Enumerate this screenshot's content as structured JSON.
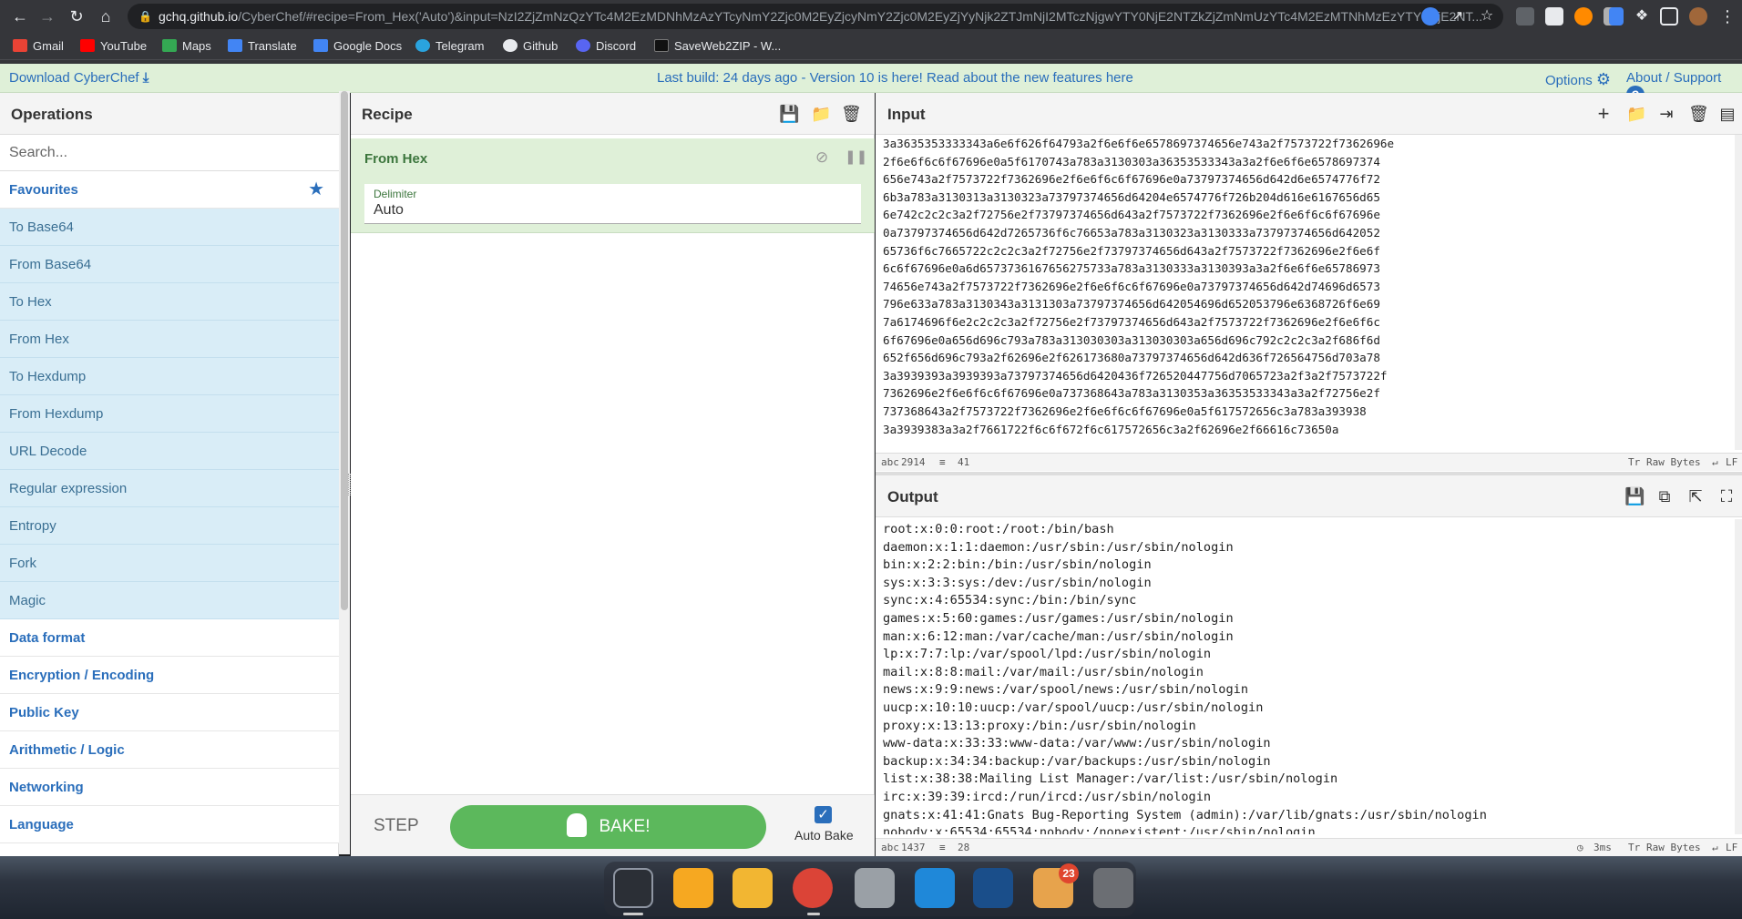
{
  "browser": {
    "url_host": "gchq.github.io",
    "url_rest": "/CyberChef/#recipe=From_Hex('Auto')&input=NzI2ZjZmNzQzYTc4M2EzMDNhMzAzYTcyNmY2Zjc0M2EyZjcyNmY2Zjc0M2EyZjYyNjk2ZTJmNjI2MTczNjgwYTY0NjE2NTZkZjZmNmUzYTc4M2EzMTNhMzEzYTY0NjE2NT...",
    "bookmarks": [
      "Gmail",
      "YouTube",
      "Maps",
      "Translate",
      "Google Docs",
      "Telegram",
      "Github",
      "Discord",
      "SaveWeb2ZIP - W..."
    ]
  },
  "banner": {
    "download": "Download CyberChef",
    "build": "Last build: 24 days ago - Version 10 is here! Read about the new features here",
    "options": "Options",
    "about": "About / Support"
  },
  "operations": {
    "title": "Operations",
    "search_placeholder": "Search...",
    "favourites": "Favourites",
    "items": [
      "To Base64",
      "From Base64",
      "To Hex",
      "From Hex",
      "To Hexdump",
      "From Hexdump",
      "URL Decode",
      "Regular expression",
      "Entropy",
      "Fork",
      "Magic"
    ],
    "categories": [
      "Data format",
      "Encryption / Encoding",
      "Public Key",
      "Arithmetic / Logic",
      "Networking",
      "Language"
    ]
  },
  "recipe": {
    "title": "Recipe",
    "operation": "From Hex",
    "delimiter_label": "Delimiter",
    "delimiter_value": "Auto",
    "step": "STEP",
    "bake": "BAKE!",
    "auto_bake": "Auto Bake",
    "auto_bake_checked": true
  },
  "input": {
    "title": "Input",
    "text": "3a3635353333343a6e6f626f64793a2f6e6f6e6578697374656e743a2f7573722f7362696e\n2f6e6f6c6f67696e0a5f6170743a783a3130303a36353533343a3a2f6e6f6e6578697374\n656e743a2f7573722f7362696e2f6e6f6c6f67696e0a73797374656d642d6e6574776f72\n6b3a783a3130313a3130323a73797374656d64204e6574776f726b204d616e6167656d65\n6e742c2c2c3a2f72756e2f73797374656d643a2f7573722f7362696e2f6e6f6c6f67696e\n0a73797374656d642d7265736f6c76653a783a3130323a3130333a73797374656d642052\n65736f6c7665722c2c2c3a2f72756e2f73797374656d643a2f7573722f7362696e2f6e6f\n6c6f67696e0a6d6573736167656275733a783a3130333a3130393a3a2f6e6f6e65786973\n74656e743a2f7573722f7362696e2f6e6f6c6f67696e0a73797374656d642d74696d6573\n796e633a783a3130343a3131303a73797374656d642054696d652053796e6368726f6e69\n7a6174696f6e2c2c2c3a2f72756e2f73797374656d643a2f7573722f7362696e2f6e6f6c\n6f67696e0a656d696c793a783a313030303a313030303a656d696c792c2c2c3a2f686f6d\n652f656d696c793a2f62696e2f626173680a73797374656d642d636f726564756d703a78\n3a3939393a3939393a73797374656d6420436f726520447756d7065723a2f3a2f7573722f\n7362696e2f6e6f6c6f67696e0a737368643a783a3130353a36353533343a3a2f72756e2f\n737368643a2f7573722f7362696e2f6e6f6c6f67696e0a5f617572656c3a783a393938\n3a3939383a3a2f7661722f6c6f672f6c617572656c3a2f62696e2f66616c73650a",
    "chars_label": "2914",
    "lines_label": "41",
    "raw_bytes": "Raw Bytes",
    "eol": "LF"
  },
  "output": {
    "title": "Output",
    "text": "root:x:0:0:root:/root:/bin/bash\ndaemon:x:1:1:daemon:/usr/sbin:/usr/sbin/nologin\nbin:x:2:2:bin:/bin:/usr/sbin/nologin\nsys:x:3:3:sys:/dev:/usr/sbin/nologin\nsync:x:4:65534:sync:/bin:/bin/sync\ngames:x:5:60:games:/usr/games:/usr/sbin/nologin\nman:x:6:12:man:/var/cache/man:/usr/sbin/nologin\nlp:x:7:7:lp:/var/spool/lpd:/usr/sbin/nologin\nmail:x:8:8:mail:/var/mail:/usr/sbin/nologin\nnews:x:9:9:news:/var/spool/news:/usr/sbin/nologin\nuucp:x:10:10:uucp:/var/spool/uucp:/usr/sbin/nologin\nproxy:x:13:13:proxy:/bin:/usr/sbin/nologin\nwww-data:x:33:33:www-data:/var/www:/usr/sbin/nologin\nbackup:x:34:34:backup:/var/backups:/usr/sbin/nologin\nlist:x:38:38:Mailing List Manager:/var/list:/usr/sbin/nologin\nirc:x:39:39:ircd:/run/ircd:/usr/sbin/nologin\ngnats:x:41:41:Gnats Bug-Reporting System (admin):/var/lib/gnats:/usr/sbin/nologin\nnobody:x:65534:65534:nobody:/nonexistent:/usr/sbin/nologin",
    "chars_label": "1437",
    "lines_label": "28",
    "time": "3ms",
    "raw_bytes": "Raw Bytes",
    "eol": "LF"
  },
  "dock": {
    "badge_count": "23"
  },
  "colors": {
    "accent": "#2a6ebb",
    "bake_green": "#5cb85c",
    "banner_bg": "#dff0d8",
    "favourite_bg": "#d9edf7"
  }
}
